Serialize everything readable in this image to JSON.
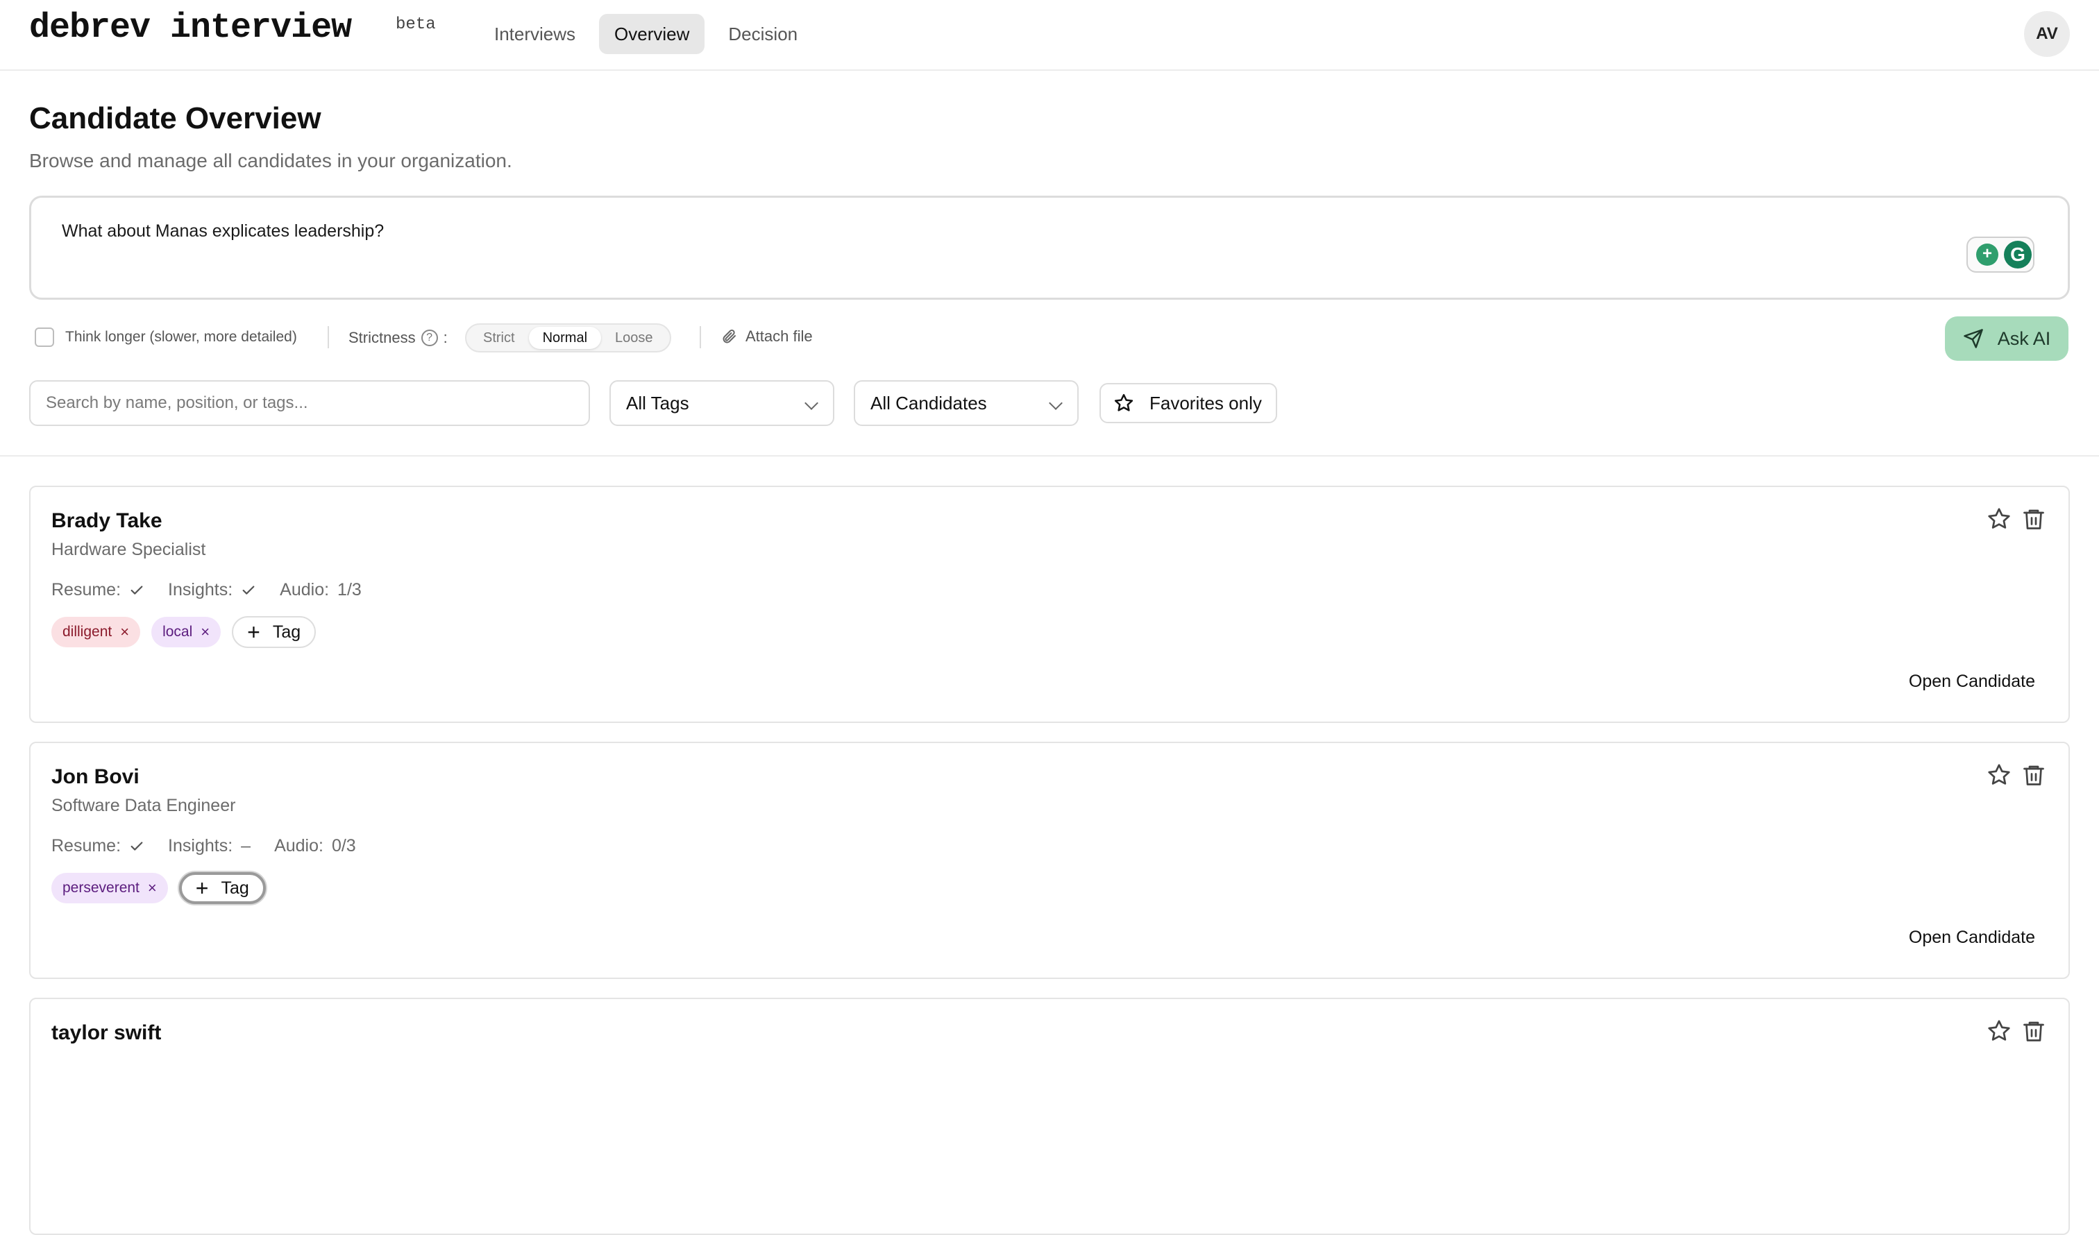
{
  "header": {
    "logo": "debrev interview",
    "badge": "beta",
    "nav": [
      "Interviews",
      "Overview",
      "Decision"
    ],
    "active_nav": "Overview",
    "avatar": "AV"
  },
  "page": {
    "title": "Candidate Overview",
    "subtitle": "Browse and manage all candidates in your organization."
  },
  "ask": {
    "query": "What about Manas explicates leadership?",
    "think_longer": "Think longer (slower, more detailed)",
    "strictness_label": "Strictness",
    "strictness_sep": ":",
    "strictness_options": [
      "Strict",
      "Normal",
      "Loose"
    ],
    "strictness_selected": "Normal",
    "attach_label": "Attach file",
    "submit_label": "Ask AI"
  },
  "filters": {
    "search_placeholder": "Search by name, position, or tags...",
    "tags_select": "All Tags",
    "candidates_select": "All Candidates",
    "favorites_label": "Favorites only"
  },
  "labels": {
    "resume": "Resume:",
    "insights": "Insights:",
    "audio": "Audio:",
    "add_tag": "Tag",
    "open_candidate": "Open Candidate"
  },
  "candidates": [
    {
      "name": "Brady Take",
      "role": "Hardware Specialist",
      "resume": "check",
      "insights": "check",
      "audio": "1/3",
      "tags": [
        {
          "label": "dilligent",
          "color": "#fbe0e3"
        },
        {
          "label": "local",
          "color": "#f1e4fb"
        }
      ]
    },
    {
      "name": "Jon Bovi",
      "role": "Software Data Engineer",
      "resume": "check",
      "insights": "–",
      "audio": "0/3",
      "tags": [
        {
          "label": "perseverent",
          "color": "#f1e4fb"
        }
      ]
    },
    {
      "name": "taylor swift",
      "role": "",
      "resume": "",
      "insights": "",
      "audio": "",
      "tags": []
    }
  ],
  "colors": {
    "accent_button": "#a7dbbb",
    "active_nav_bg": "#e7e7e7"
  }
}
